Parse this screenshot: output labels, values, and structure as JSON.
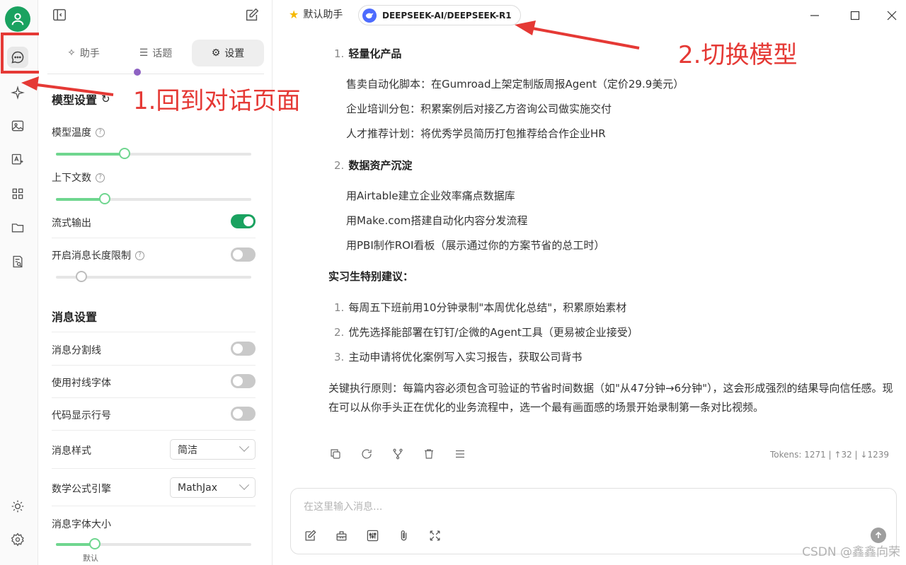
{
  "rail": {
    "items": [
      "chat",
      "assistant",
      "image",
      "translate",
      "apps",
      "files",
      "knowledge"
    ],
    "bottom": [
      "theme",
      "settings"
    ]
  },
  "panel": {
    "tabs": [
      {
        "label": "助手",
        "icon": "sparkle-icon"
      },
      {
        "label": "话题",
        "icon": "list-icon"
      },
      {
        "label": "设置",
        "icon": "gear-icon"
      }
    ],
    "active_tab": 2,
    "model_settings": {
      "title": "模型设置",
      "temperature_label": "模型温度",
      "temperature_level": 0.35,
      "context_label": "上下文数",
      "context_level": 0.25,
      "stream_label": "流式输出",
      "stream_on": true,
      "max_length_label": "开启消息长度限制",
      "max_length_on": false
    },
    "message_settings": {
      "title": "消息设置",
      "divider_label": "消息分割线",
      "serif_label": "使用衬线字体",
      "line_numbers_label": "代码显示行号",
      "style_label": "消息样式",
      "style_value": "简洁",
      "math_label": "数学公式引擎",
      "math_value": "MathJax",
      "font_size_label": "消息字体大小",
      "font_size_level": 0.2,
      "font_size_partial": "默认"
    }
  },
  "titlebar": {
    "assistant": "默认助手",
    "model": "DEEPSEEK-AI/DEEPSEEK-R1"
  },
  "chat": {
    "section1": {
      "num": "1.",
      "title": "轻量化产品"
    },
    "section1_items": [
      "售卖自动化脚本：在Gumroad上架定制版周报Agent（定价29.9美元）",
      "企业培训分包：积累案例后对接乙方咨询公司做实施交付",
      "人才推荐计划：将优秀学员简历打包推荐给合作企业HR"
    ],
    "section2": {
      "num": "2.",
      "title": "数据资产沉淀"
    },
    "section2_items": [
      "用Airtable建立企业效率痛点数据库",
      "用Make.com搭建自动化内容分发流程",
      "用PBI制作ROI看板（展示通过你的方案节省的总工时）"
    ],
    "intern_title": "实习生特别建议：",
    "intern_items": [
      {
        "num": "1.",
        "text": "每周五下班前用10分钟录制\"本周优化总结\"，积累原始素材"
      },
      {
        "num": "2.",
        "text": "优先选择能部署在钉钉/企微的Agent工具（更易被企业接受）"
      },
      {
        "num": "3.",
        "text": "主动申请将优化案例写入实习报告，获取公司背书"
      }
    ],
    "closing": "关键执行原则：每篇内容必须包含可验证的节省时间数据（如\"从47分钟→6分钟\"），这会形成强烈的结果导向信任感。现在可以从你手头正在优化的业务流程中，选一个最有画面感的场景开始录制第一条对比视频。",
    "tokens": "Tokens: 1271 | ↑32 | ↓1239"
  },
  "input": {
    "placeholder": "在这里输入消息..."
  },
  "annotations": {
    "a1": "1.回到对话页面",
    "a2": "2.切换模型"
  },
  "watermark": "CSDN @鑫鑫向荣",
  "colors": {
    "accent": "#1aa260",
    "annotation": "#e53935",
    "slider": "#6fd68f"
  }
}
